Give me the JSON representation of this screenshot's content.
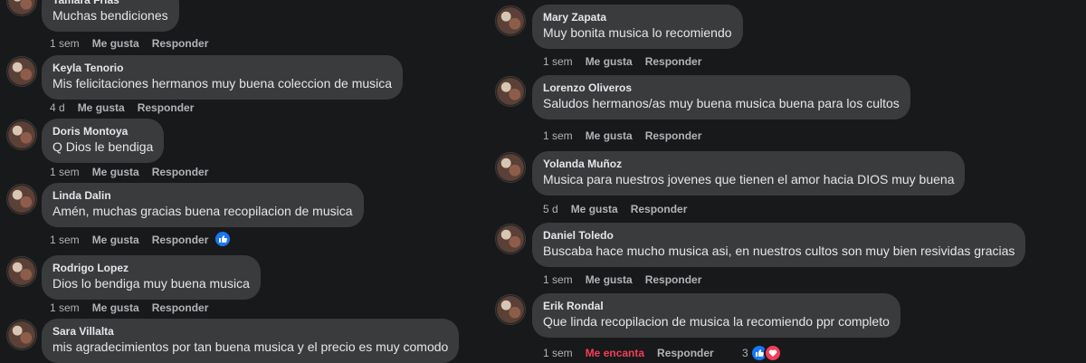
{
  "left_comments": [
    {
      "name": "Tamara Frias",
      "text": "Muchas bendiciones",
      "time": "1 sem",
      "like": "Me gusta",
      "reply": "Responder"
    },
    {
      "name": "Keyla Tenorio",
      "text": "Mis felicitaciones hermanos muy buena coleccion de musica",
      "time": "4 d",
      "like": "Me gusta",
      "reply": "Responder"
    },
    {
      "name": "Doris Montoya",
      "text": "Q Dios le bendiga",
      "time": "1 sem",
      "like": "Me gusta",
      "reply": "Responder"
    },
    {
      "name": "Linda Dalin",
      "text": "Amén, muchas gracias buena recopilacion de musica",
      "time": "1 sem",
      "like": "Me gusta",
      "reply": "Responder"
    },
    {
      "name": "Rodrigo Lopez",
      "text": "Dios lo bendiga muy buena musica",
      "time": "1 sem",
      "like": "Me gusta",
      "reply": "Responder"
    },
    {
      "name": "Sara Villalta",
      "text": "mis agradecimientos por tan buena musica y el precio es muy comodo",
      "time": "",
      "like": "",
      "reply": ""
    }
  ],
  "right_comments": [
    {
      "name": "Mary Zapata",
      "text": "Muy bonita musica lo recomiendo",
      "time": "1 sem",
      "like": "Me gusta",
      "reply": "Responder"
    },
    {
      "name": "Lorenzo Oliveros",
      "text": "Saludos hermanos/as muy buena musica buena para los cultos",
      "time": "1 sem",
      "like": "Me gusta",
      "reply": "Responder"
    },
    {
      "name": "Yolanda Muñoz",
      "text": "Musica para nuestros jovenes que tienen el amor hacia DIOS muy buena",
      "time": "5 d",
      "like": "Me gusta",
      "reply": "Responder"
    },
    {
      "name": "Daniel Toledo",
      "text": "Buscaba hace mucho musica asi, en nuestros cultos son muy bien resividas gracias",
      "time": "1 sem",
      "like": "Me gusta",
      "reply": "Responder"
    },
    {
      "name": "Erik Rondal",
      "text": "Que linda recopilacion de musica la recomiendo ppr completo",
      "time": "1 sem",
      "like": "Me encanta",
      "reply": "Responder"
    }
  ],
  "reactions": {
    "linda_dalin": {
      "icons": [
        "like-icon"
      ]
    },
    "erik_rondal": {
      "count": "3",
      "icons": [
        "like-icon",
        "heart-icon"
      ]
    }
  },
  "colors": {
    "background": "#18191a",
    "bubble": "#3a3b3c",
    "love": "#f33e58",
    "like_badge": "#1877f2"
  }
}
